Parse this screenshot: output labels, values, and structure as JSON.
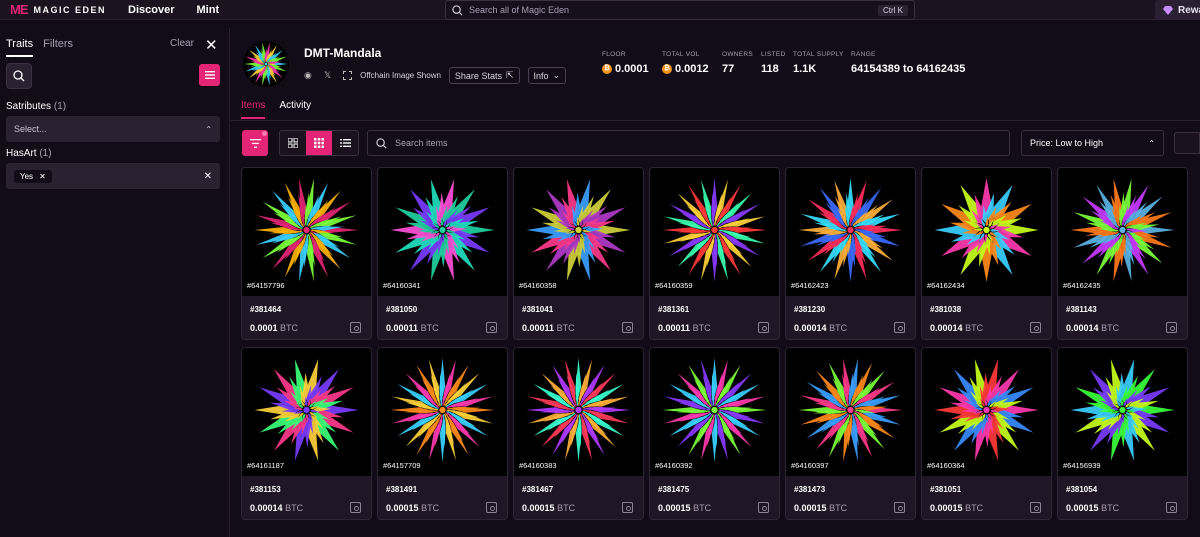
{
  "topbar": {
    "logo_mark": "ME",
    "logo_text": "MAGIC EDEN",
    "nav": [
      "Discover",
      "Mint"
    ],
    "search_placeholder": "Search all of Magic Eden",
    "shortcut": "Ctrl K",
    "rewards_label": "Rewa"
  },
  "sidebar": {
    "tab_traits": "Traits",
    "tab_filters": "Filters",
    "clear": "Clear",
    "trait_groups": [
      {
        "name": "Satributes",
        "count": "(1)",
        "select_placeholder": "Select..."
      },
      {
        "name": "HasArt",
        "count": "(1)",
        "chip": "Yes"
      }
    ]
  },
  "collection": {
    "name": "DMT-Mandala",
    "offchain": "Offchain Image Shown",
    "share": "Share Stats",
    "info": "Info",
    "stats": [
      {
        "label": "FLOOR",
        "value": "0.0001",
        "btc": true
      },
      {
        "label": "TOTAL VOL",
        "value": "0.0012",
        "btc": true
      },
      {
        "label": "OWNERS",
        "value": "77"
      },
      {
        "label": "LISTED",
        "value": "118"
      },
      {
        "label": "TOTAL SUPPLY",
        "value": "1.1K"
      },
      {
        "label": "RANGE",
        "value": "64154389 to 64162435"
      }
    ]
  },
  "subtabs": {
    "items": "Items",
    "activity": "Activity"
  },
  "toolbar": {
    "search_placeholder": "Search items",
    "sort": "Price: Low to High"
  },
  "currency_unit": "BTC",
  "items": [
    {
      "inscription": "#64157796",
      "num": "#381464",
      "price": "0.0001",
      "palette": [
        "#e42575",
        "#7cff3a",
        "#3ad0ff",
        "#ffb300"
      ],
      "petals": 22
    },
    {
      "inscription": "#64160341",
      "num": "#381050",
      "price": "0.00011",
      "palette": [
        "#1fd1a0",
        "#7a3cff",
        "#20e0c0",
        "#ff4fd8"
      ],
      "petals": 14
    },
    {
      "inscription": "#64160358",
      "num": "#381041",
      "price": "0.00011",
      "palette": [
        "#d1d13a",
        "#b03ac8",
        "#ff3a8c",
        "#3aa0ff"
      ],
      "petals": 14
    },
    {
      "inscription": "#64160359",
      "num": "#381361",
      "price": "0.00011",
      "palette": [
        "#ff3a3a",
        "#3affb0",
        "#8a3aff",
        "#ffd23a"
      ],
      "petals": 24
    },
    {
      "inscription": "#64162423",
      "num": "#381230",
      "price": "0.00014",
      "palette": [
        "#ff2e5a",
        "#3a6bff",
        "#ffb03a",
        "#35e0ff"
      ],
      "petals": 20
    },
    {
      "inscription": "#64162434",
      "num": "#381038",
      "price": "0.00014",
      "palette": [
        "#c8ff1a",
        "#ff3ab0",
        "#3ad0ff",
        "#ff8a1a"
      ],
      "petals": 12
    },
    {
      "inscription": "#64162435",
      "num": "#381143",
      "price": "0.00014",
      "palette": [
        "#5ab4e6",
        "#ff7a1a",
        "#7cff3a",
        "#c83aff"
      ],
      "petals": 18
    },
    {
      "inscription": "#64161187",
      "num": "#381153",
      "price": "0.00014",
      "palette": [
        "#7a3cff",
        "#ff3a8c",
        "#3aff7a",
        "#ffd23a"
      ],
      "petals": 14
    },
    {
      "inscription": "#64157709",
      "num": "#381491",
      "price": "0.00015",
      "palette": [
        "#ff8a1a",
        "#ffd23a",
        "#3ad0ff",
        "#ff3ab0"
      ],
      "petals": 24
    },
    {
      "inscription": "#64160383",
      "num": "#381467",
      "price": "0.00015",
      "palette": [
        "#b03aff",
        "#ff3a5a",
        "#3affd0",
        "#ffb03a"
      ],
      "petals": 24
    },
    {
      "inscription": "#64160392",
      "num": "#381475",
      "price": "0.00015",
      "palette": [
        "#7cff3a",
        "#8a3aff",
        "#3ad0ff",
        "#ff3ab0"
      ],
      "petals": 24
    },
    {
      "inscription": "#64160397",
      "num": "#381473",
      "price": "0.00015",
      "palette": [
        "#ff3a8c",
        "#3aa0ff",
        "#ff8a1a",
        "#7cff3a"
      ],
      "petals": 22
    },
    {
      "inscription": "#64160364",
      "num": "#381051",
      "price": "0.00015",
      "palette": [
        "#ff3ab0",
        "#3a8cff",
        "#c8ff1a",
        "#ff3a3a"
      ],
      "petals": 14
    },
    {
      "inscription": "#64156939",
      "num": "#381054",
      "price": "0.00015",
      "palette": [
        "#3aff3a",
        "#7a3cff",
        "#c8ff1a",
        "#3ad0ff"
      ],
      "petals": 14
    }
  ]
}
